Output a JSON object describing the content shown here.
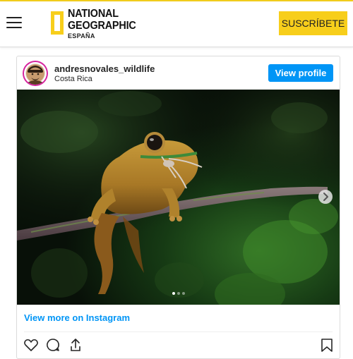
{
  "header": {
    "logo": {
      "line1": "NATIONAL",
      "line2": "GEOGRAPHIC",
      "line3": "ESPAÑA"
    },
    "subscribe_label": "SUSCRÍBETE",
    "menu_icon": "hamburger-icon"
  },
  "instagram_embed": {
    "username": "andresnovales_wildlife",
    "location": "Costa Rica",
    "view_profile_label": "View profile",
    "view_more_label": "View more on Instagram",
    "carousel": {
      "current_slide": 1,
      "total_slides": 3
    },
    "icons": {
      "next": "chevron-right-icon",
      "like": "heart-icon",
      "comment": "comment-icon",
      "share": "share-icon",
      "save": "bookmark-icon"
    }
  },
  "colors": {
    "brand_yellow": "#f7ce1b",
    "instagram_blue": "#0095f6",
    "text_dark": "#262626"
  }
}
